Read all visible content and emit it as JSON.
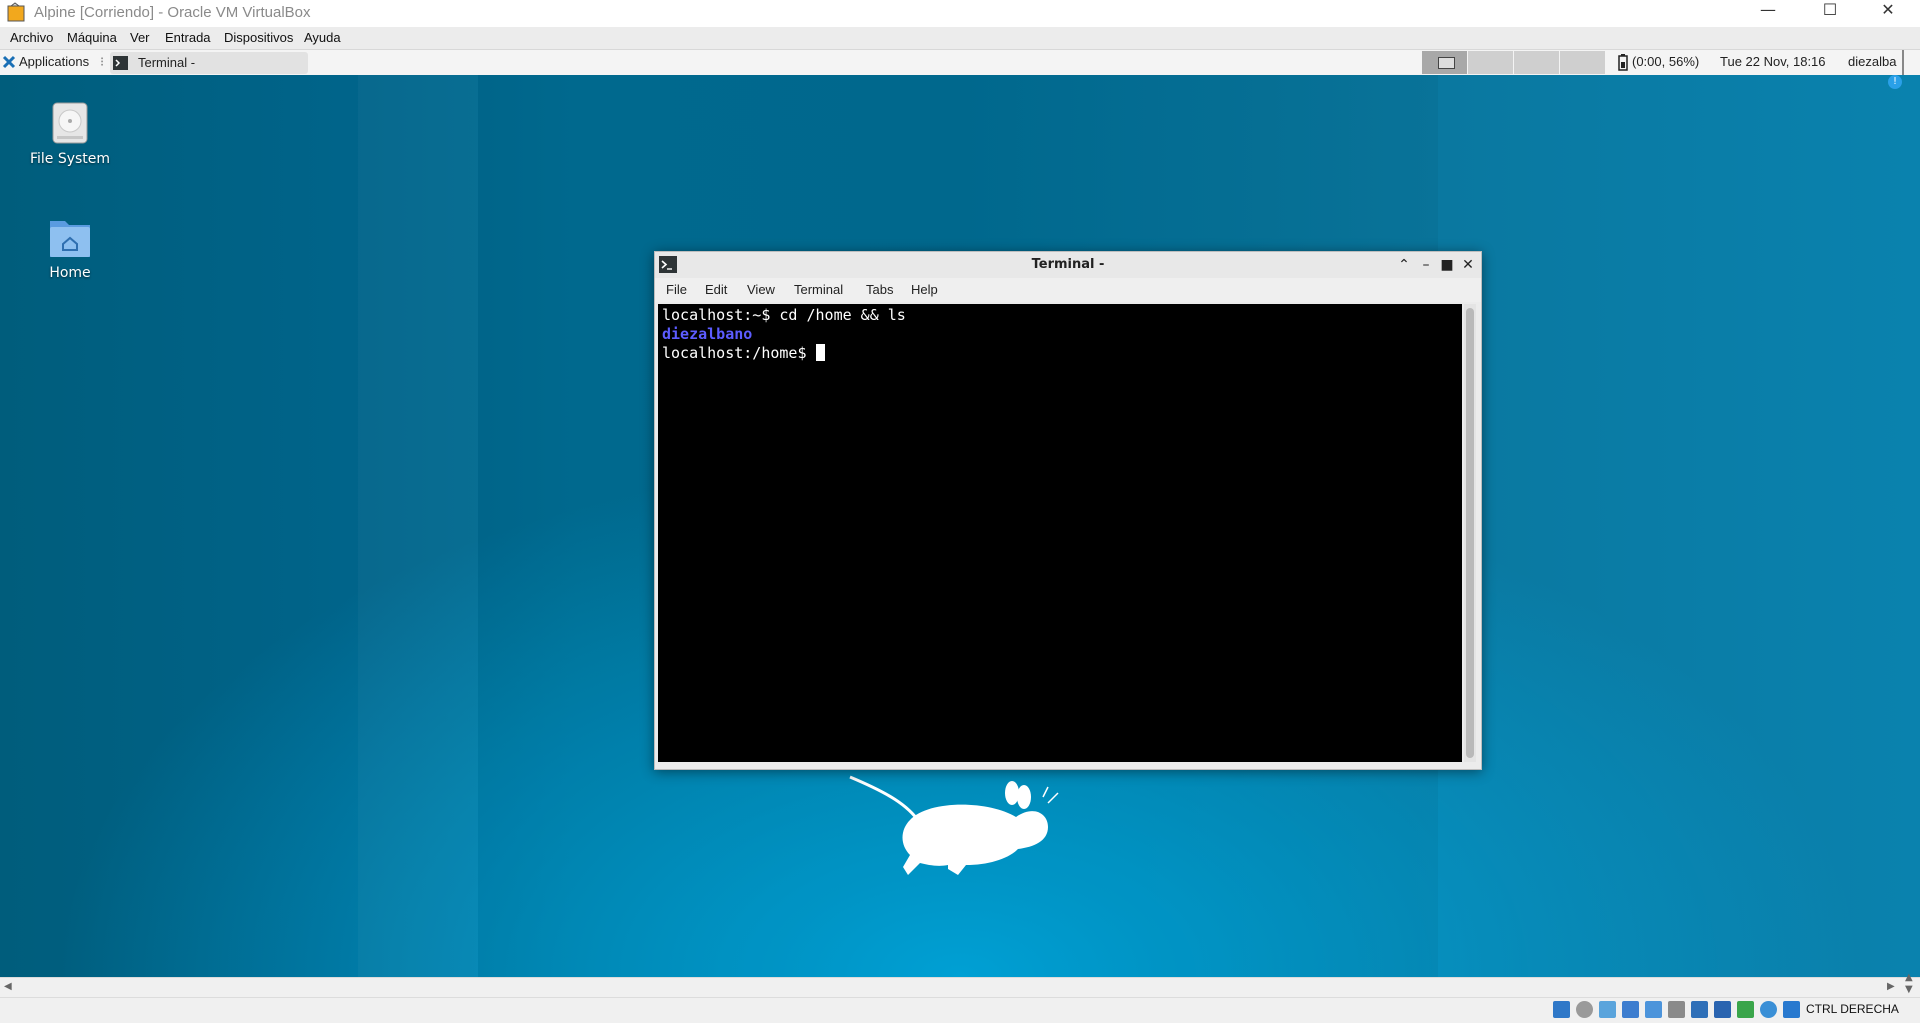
{
  "host": {
    "title": "Alpine [Corriendo] - Oracle VM VirtualBox",
    "menu": [
      "Archivo",
      "Máquina",
      "Ver",
      "Entrada",
      "Dispositivos",
      "Ayuda"
    ],
    "host_key": "CTRL DERECHA"
  },
  "panel": {
    "applications_label": "Applications",
    "task_label": "Terminal -",
    "battery": "(0:00, 56%)",
    "clock": "Tue 22 Nov, 18:16",
    "user": "diezalba"
  },
  "desktop": {
    "icons": [
      {
        "label": "File System",
        "icon": "drive-icon"
      },
      {
        "label": "Home",
        "icon": "home-folder-icon"
      }
    ]
  },
  "terminal": {
    "title": "Terminal -",
    "menu": [
      "File",
      "Edit",
      "View",
      "Terminal",
      "Tabs",
      "Help"
    ],
    "lines": [
      {
        "text": "localhost:~$ cd /home && ls"
      },
      {
        "text": "diezalbano",
        "color": "#5c5cff"
      },
      {
        "text": "localhost:/home$ "
      }
    ]
  }
}
